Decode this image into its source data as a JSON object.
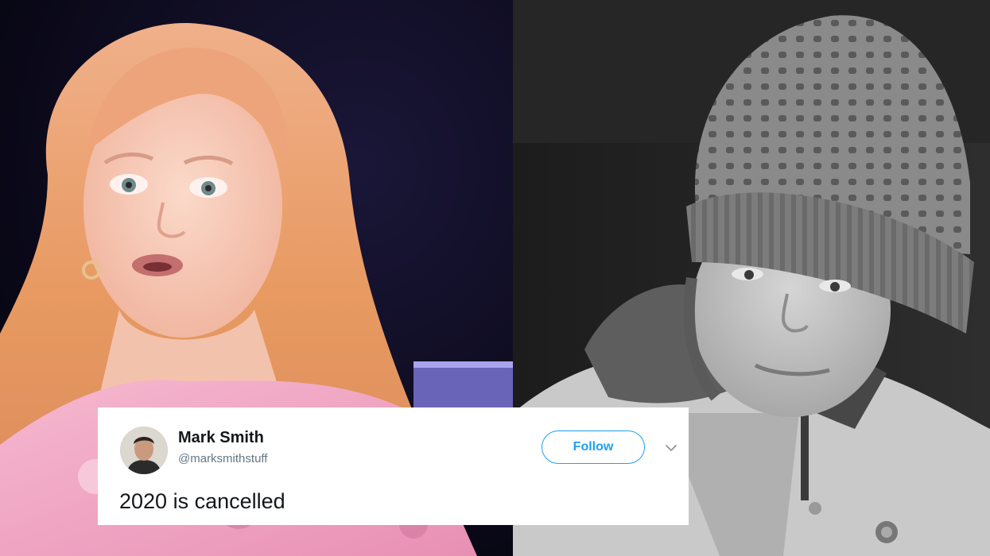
{
  "tweet": {
    "display_name": "Mark Smith",
    "handle": "@marksmithstuff",
    "follow_label": "Follow",
    "text": "2020 is cancelled"
  },
  "photos": {
    "left": {
      "style": "color",
      "subject": "red-haired-woman-on-stage"
    },
    "right": {
      "style": "black-and-white",
      "subject": "girl-in-knit-beanie"
    }
  },
  "colors": {
    "follow_accent": "#1da1f2",
    "handle_gray": "#657786",
    "text_dark": "#14171a"
  }
}
